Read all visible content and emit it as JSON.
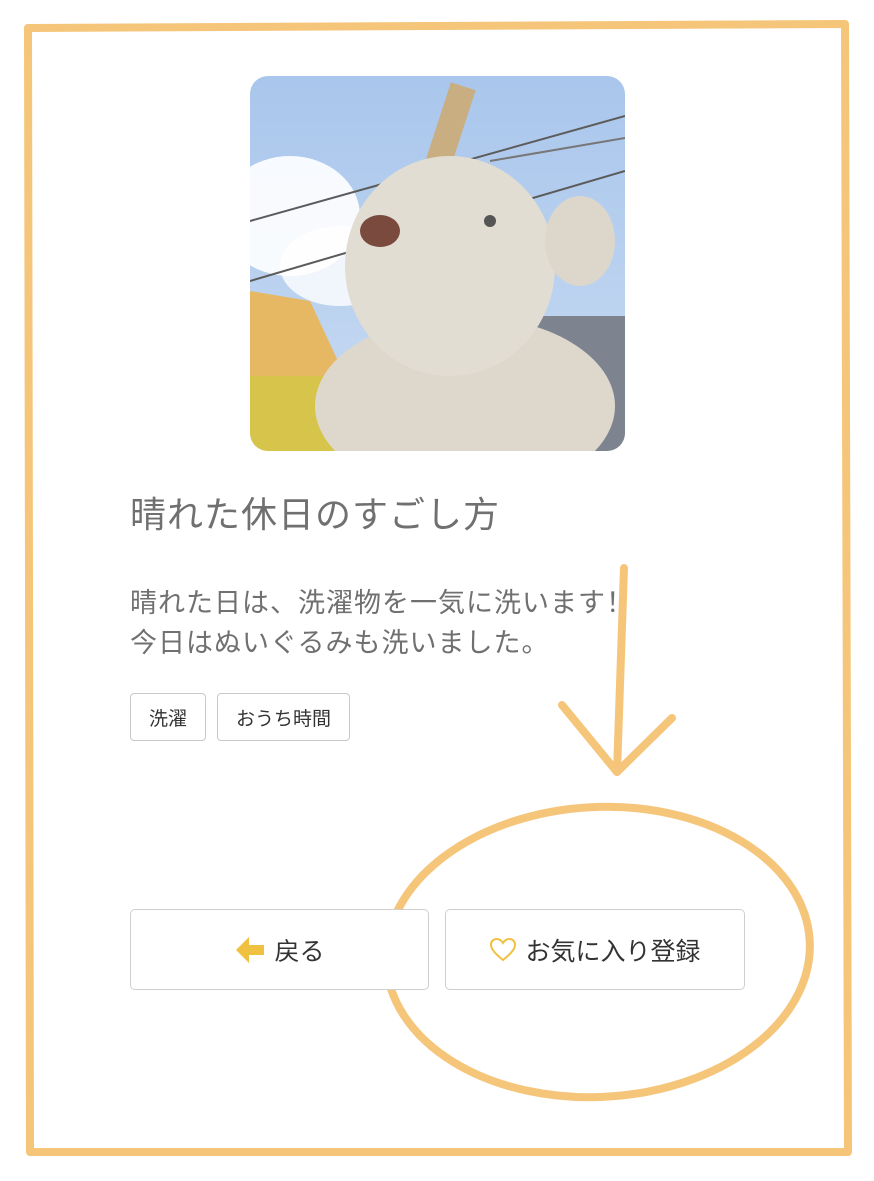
{
  "post": {
    "title": "晴れた休日のすごし方",
    "description_lines": [
      "晴れた日は、洗濯物を一気に洗います！",
      "今日はぬいぐるみも洗いました。"
    ],
    "tags": [
      "洗濯",
      "おうち時間"
    ]
  },
  "actions": {
    "back_label": "戻る",
    "favorite_label": "お気に入り登録"
  },
  "icons": {
    "back": "arrow-left-icon",
    "favorite": "heart-outline-icon"
  },
  "colors": {
    "annotation": "#f5c57a",
    "icon_accent": "#f0c040",
    "text": "#707070"
  }
}
